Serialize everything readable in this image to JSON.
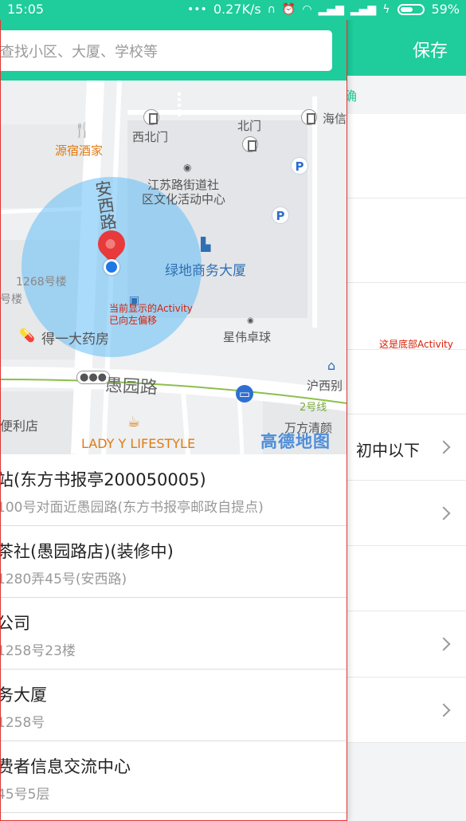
{
  "status_bar": {
    "time": "15:05",
    "net_speed": "0.27K/s",
    "battery": "59%",
    "battery_level": 0.59
  },
  "bottom_activity": {
    "save_label": "保存",
    "tip_char": "确",
    "note": "这是底部Activity",
    "rows": [
      {
        "label": ""
      },
      {
        "label": ""
      },
      {
        "label": ""
      },
      {
        "label": ""
      },
      {
        "label": "初中以下"
      },
      {
        "label": ""
      },
      {
        "label": ""
      },
      {
        "label": ""
      },
      {
        "label": ""
      }
    ]
  },
  "current_activity": {
    "search_placeholder": "查找小区、大厦、学校等",
    "overlay_note_line1": "当前显示的Activity",
    "overlay_note_line2": "已向左偏移",
    "map": {
      "labels": {
        "restaurant": "源宿酒家",
        "west_north_gate": "西北门",
        "north_gate": "北门",
        "haixin": "海信",
        "community_center_1": "江苏路街道社",
        "community_center_2": "区文化活动中心",
        "road_anxi": "安西路",
        "building_1268": "1268号楼",
        "building_partial": "号楼",
        "lvdi": "绿地商务大厦",
        "pharmacy": "得一大药房",
        "xingwei": "星伟卓球",
        "road_huiyuan": "愚园路",
        "hu_xi": "沪西别",
        "metro_line": "2号线",
        "convenience": "便利店",
        "cafe": "LADY Y LIFESTYLE",
        "wanfang": "万方清颜",
        "amap": "高德地图"
      }
    },
    "pois": [
      {
        "name": "站(东方书报亭200050005)",
        "addr": "100号对面近愚园路(东方书报亭邮政自提点)"
      },
      {
        "name": "茶社(愚园路店)(装修中)",
        "addr": "1280弄45号(安西路)"
      },
      {
        "name": "公司",
        "addr": "1258号23楼"
      },
      {
        "name": "务大厦",
        "addr": "1258号"
      },
      {
        "name": "费者信息交流中心",
        "addr": "45号5层"
      }
    ]
  }
}
